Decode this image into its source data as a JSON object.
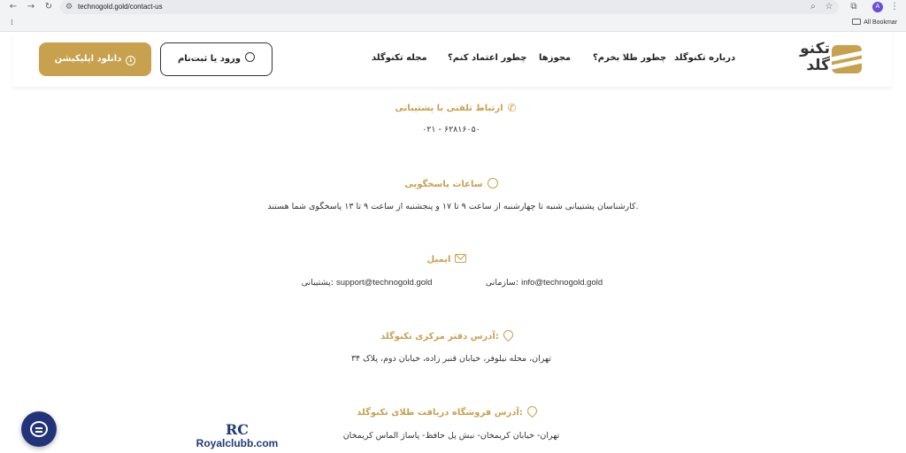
{
  "browser": {
    "url": "technogold.gold/contact-us",
    "bookmarks_folder": "All Bookmar",
    "profile_initial": "A"
  },
  "header": {
    "logo_text": "تکنو گلد",
    "nav": [
      "درباره تکنوگلد",
      "چطور طلا بخرم؟",
      "مجوزها",
      "چطور اعتماد کنم؟",
      "مجله تکنوگلد"
    ],
    "login_label": "ورود یا ثبت‌نام",
    "download_label": "دانلود اپلیکیشن",
    "accent_color": "#c8a14f"
  },
  "sections": {
    "phone": {
      "title": "ارتباط تلفنی با پشتیبانی",
      "value": "۰۲۱ - ۶۲۸۱۶۰۵۰"
    },
    "hours": {
      "title": "ساعات پاسخگویی",
      "value": "کارشناسان پشتیبانی شنبه تا چهارشنبه از ساعت ۹ تا ۱۷ و پنجشنبه از ساعت ۹ تا ۱۳ پاسخگوی شما هستند."
    },
    "email": {
      "title": "ایمیل",
      "org_label": "سازمانی:",
      "org_value": "info@technogold.gold",
      "support_label": "پشتیبانی:",
      "support_value": "support@technogold.gold"
    },
    "office": {
      "title": "آدرس دفتر مرکزی تکنوگلد:",
      "value": "تهران، محله نیلوفر، خیابان قنبر زاده، خیابان دوم، پلاک ۳۴"
    },
    "store": {
      "title": "آدرس فروشگاه دریافت طلای تکنوگلد:",
      "value": "تهران- خیابان کریمخان- نبش پل حافظ- پاساژ الماس کریمخان"
    }
  },
  "watermark": {
    "logo": "RC",
    "text": "Royalclubb.com"
  }
}
